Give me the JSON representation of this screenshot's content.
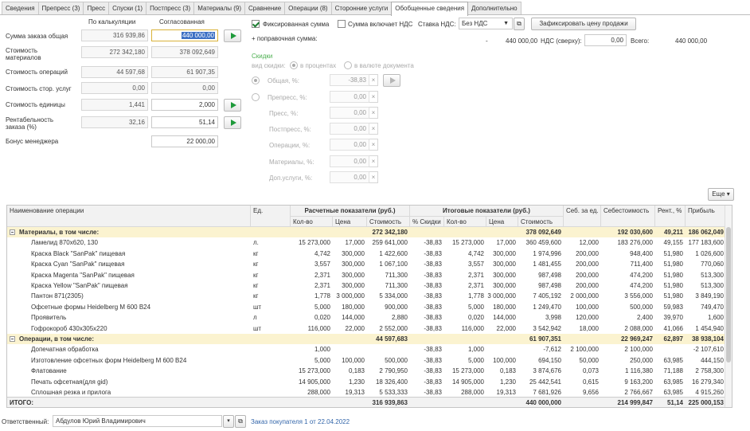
{
  "tabs": [
    "Сведения",
    "Препресс (3)",
    "Пресс",
    "Спуски (1)",
    "Постпресс (3)",
    "Материалы (9)",
    "Сравнение",
    "Операции (8)",
    "Сторонние услуги",
    "Обобщенные сведения",
    "Дополнительно"
  ],
  "form": {
    "col_calc": "По калькуляции",
    "col_agreed": "Согласованная",
    "rows": [
      {
        "label": "Сумма заказа общая",
        "calc": "316 939,86",
        "agreed": "440 000,00"
      },
      {
        "label": "Стоимость материалов",
        "calc": "272 342,180",
        "agreed": "378 092,649"
      },
      {
        "label": "Стоимость операций",
        "calc": "44 597,68",
        "agreed": "61 907,35"
      },
      {
        "label": "Стоимость стор. услуг",
        "calc": "0,00",
        "agreed": "0,00"
      },
      {
        "label": "Стоимость единицы",
        "calc": "1,441",
        "agreed": "2,000"
      },
      {
        "label": "Рентабельность заказа (%)",
        "calc": "32,16",
        "agreed": "51,14"
      },
      {
        "label": "Бонус менеджера",
        "agreed": "22 000,00"
      }
    ]
  },
  "right": {
    "fixed_sum": "Фиксированная сумма",
    "vat_incl": "Сумма включает НДС",
    "vat_rate_lbl": "Ставка НДС:",
    "vat_rate": "Без НДС",
    "fix_price_btn": "Зафиксировать цену продажи",
    "correction": "+ поправочная сумма:",
    "dash": "-",
    "sum": "440 000,00",
    "vat_top_lbl": "НДС (сверху):",
    "vat_top": "0,00",
    "total_lbl": "Всего:",
    "total": "440 000,00",
    "discounts": "Скидки",
    "disc_kind": "вид скидки:",
    "in_percent": "в процентах",
    "in_currency": "в валюте документа",
    "disc_rows": [
      {
        "label": "Общая, %:",
        "value": "-38,83"
      },
      {
        "label": "Препресс, %:",
        "value": "0,00"
      },
      {
        "label": "Пресс, %:",
        "value": "0,00"
      },
      {
        "label": "Постпресс, %:",
        "value": "0,00"
      },
      {
        "label": "Операции, %:",
        "value": "0,00"
      },
      {
        "label": "Материалы, %:",
        "value": "0,00"
      },
      {
        "label": "Доп.услуги, %:",
        "value": "0,00"
      }
    ]
  },
  "more_btn": "Еще",
  "table": {
    "h_name": "Наименование операции",
    "h_unit": "Ед.",
    "h_calc": "Расчетные показатели (руб.)",
    "h_final": "Итоговые показатели (руб.)",
    "h_costu": "Себ. за ед.",
    "h_cost": "Себестоимость",
    "h_rent": "Рент., %",
    "h_profit": "Прибыль",
    "h_qty": "Кол-во",
    "h_price": "Цена",
    "h_sum": "Стоимость",
    "h_disc": "% Скидки",
    "h_qty2": "Кол-во",
    "h_price2": "Цена",
    "h_sum2": "Стоимость",
    "rows": [
      {
        "g": 1,
        "c": [
          "Материалы, в том числе:",
          "",
          "",
          "",
          "272 342,180",
          "",
          "",
          "",
          "378 092,649",
          "",
          "192 030,600",
          "49,211",
          "186 062,049"
        ]
      },
      {
        "c": [
          "Ламелид 870х620, 130",
          "л.",
          "15 273,000",
          "17,000",
          "259 641,000",
          "-38,83",
          "15 273,000",
          "17,000",
          "360 459,600",
          "12,000",
          "183 276,000",
          "49,155",
          "177 183,600"
        ]
      },
      {
        "c": [
          "Краска Black \"SanPak\" пищевая",
          "кг",
          "4,742",
          "300,000",
          "1 422,600",
          "-38,83",
          "4,742",
          "300,000",
          "1 974,996",
          "200,000",
          "948,400",
          "51,980",
          "1 026,600"
        ]
      },
      {
        "c": [
          "Краска Cyan \"SanPak\" пищевая",
          "кг",
          "3,557",
          "300,000",
          "1 067,100",
          "-38,83",
          "3,557",
          "300,000",
          "1 481,455",
          "200,000",
          "711,400",
          "51,980",
          "770,060"
        ]
      },
      {
        "c": [
          "Краска Magenta \"SanPak\" пищевая",
          "кг",
          "2,371",
          "300,000",
          "711,300",
          "-38,83",
          "2,371",
          "300,000",
          "987,498",
          "200,000",
          "474,200",
          "51,980",
          "513,300"
        ]
      },
      {
        "c": [
          "Краска Yellow \"SanPak\" пищевая",
          "кг",
          "2,371",
          "300,000",
          "711,300",
          "-38,83",
          "2,371",
          "300,000",
          "987,498",
          "200,000",
          "474,200",
          "51,980",
          "513,300"
        ]
      },
      {
        "c": [
          "Пантон 871(2305)",
          "кг",
          "1,778",
          "3 000,000",
          "5 334,000",
          "-38,83",
          "1,778",
          "3 000,000",
          "7 405,192",
          "2 000,000",
          "3 556,000",
          "51,980",
          "3 849,190"
        ]
      },
      {
        "c": [
          "Офсетные формы Heidelberg M 600 B24",
          "шт",
          "5,000",
          "180,000",
          "900,000",
          "-38,83",
          "5,000",
          "180,000",
          "1 249,470",
          "100,000",
          "500,000",
          "59,983",
          "749,470"
        ]
      },
      {
        "c": [
          "Проявитель",
          "л",
          "0,020",
          "144,000",
          "2,880",
          "-38,83",
          "0,020",
          "144,000",
          "3,998",
          "120,000",
          "2,400",
          "39,970",
          "1,600"
        ]
      },
      {
        "c": [
          "Гофрокороб 430х305х220",
          "шт",
          "116,000",
          "22,000",
          "2 552,000",
          "-38,83",
          "116,000",
          "22,000",
          "3 542,942",
          "18,000",
          "2 088,000",
          "41,066",
          "1 454,940"
        ]
      },
      {
        "g": 1,
        "c": [
          "Операции, в том числе:",
          "",
          "",
          "",
          "44 597,683",
          "",
          "",
          "",
          "61 907,351",
          "",
          "22 969,247",
          "62,897",
          "38 938,104"
        ]
      },
      {
        "c": [
          "Допечатная обработка",
          "",
          "1,000",
          "",
          "",
          "-38,83",
          "1,000",
          "",
          "-7,612",
          "2 100,000",
          "2 100,000",
          "",
          "-2 107,610"
        ]
      },
      {
        "c": [
          "Изготовление офсетных форм Heidelberg M 600 B24",
          "",
          "5,000",
          "100,000",
          "500,000",
          "-38,83",
          "5,000",
          "100,000",
          "694,150",
          "50,000",
          "250,000",
          "63,985",
          "444,150"
        ]
      },
      {
        "c": [
          "Флатование",
          "",
          "15 273,000",
          "0,183",
          "2 790,950",
          "-38,83",
          "15 273,000",
          "0,183",
          "3 874,676",
          "0,073",
          "1 116,380",
          "71,188",
          "2 758,300"
        ]
      },
      {
        "c": [
          "Печать офсетная(для gid)",
          "",
          "14 905,000",
          "1,230",
          "18 326,400",
          "-38,83",
          "14 905,000",
          "1,230",
          "25 442,541",
          "0,615",
          "9 163,200",
          "63,985",
          "16 279,340"
        ]
      },
      {
        "c": [
          "Сплошная резка и прилога",
          "",
          "288,000",
          "19,313",
          "5 533,333",
          "-38,83",
          "288,000",
          "19,313",
          "7 681,926",
          "9,656",
          "2 766,667",
          "63,985",
          "4 915,260"
        ]
      }
    ],
    "total": {
      "label": "ИТОГО:",
      "sum": "316 939,863",
      "sum2": "440 000,000",
      "cost": "214 999,847",
      "rent": "51,14",
      "profit": "225 000,153"
    }
  },
  "bottom": {
    "resp_lbl": "Ответственный:",
    "resp": "Абдулов Юрий Владимирович",
    "order_link": "Заказ покупателя 1 от 22.04.2022"
  }
}
